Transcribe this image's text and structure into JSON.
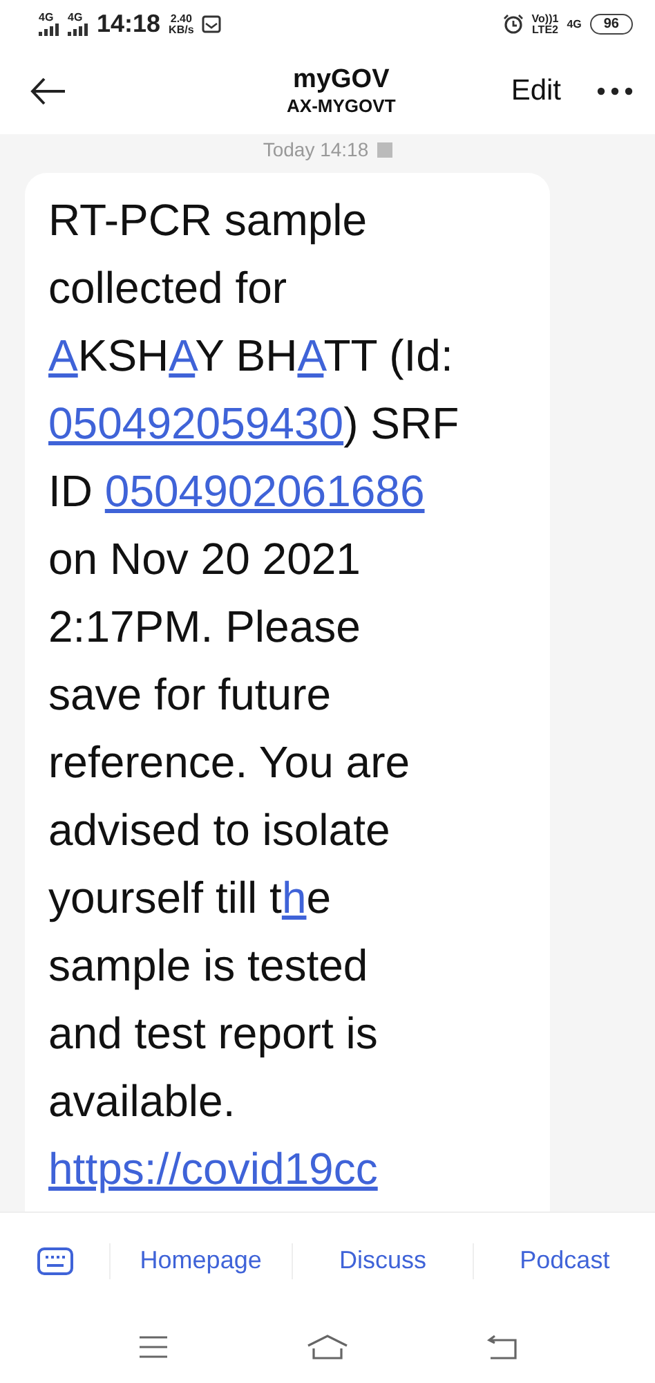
{
  "status_bar": {
    "sim1": "4G",
    "sim2": "4G",
    "time": "14:18",
    "speed": "2.40",
    "speed_unit": "KB/s",
    "volte": "Vo))1",
    "lte": "LTE2",
    "network": "4G",
    "battery": "96"
  },
  "header": {
    "title": "myGOV",
    "subtitle": "AX-MYGOVT",
    "edit": "Edit"
  },
  "date": "Today 14:18",
  "message": {
    "lines": [
      [
        {
          "kind": "text",
          "text": "RT-PCR sample"
        }
      ],
      [
        {
          "kind": "text",
          "text": "collected for"
        }
      ],
      [
        {
          "kind": "link",
          "text": "A"
        },
        {
          "kind": "text",
          "text": "KSH"
        },
        {
          "kind": "link",
          "text": "A"
        },
        {
          "kind": "text",
          "text": "Y BH"
        },
        {
          "kind": "link",
          "text": "A"
        },
        {
          "kind": "text",
          "text": "TT (Id:"
        }
      ],
      [
        {
          "kind": "link",
          "text": "050492059430"
        },
        {
          "kind": "text",
          "text": ") SRF"
        }
      ],
      [
        {
          "kind": "text",
          "text": "ID "
        },
        {
          "kind": "link",
          "text": "0504902061686"
        }
      ],
      [
        {
          "kind": "text",
          "text": "on Nov 20 2021"
        }
      ],
      [
        {
          "kind": "text",
          "text": "2:17PM. Please"
        }
      ],
      [
        {
          "kind": "text",
          "text": "save for future"
        }
      ],
      [
        {
          "kind": "text",
          "text": "reference. You are"
        }
      ],
      [
        {
          "kind": "text",
          "text": "advised to isolate"
        }
      ],
      [
        {
          "kind": "text",
          "text": "yourself till t"
        },
        {
          "kind": "link",
          "text": "h"
        },
        {
          "kind": "text",
          "text": "e"
        }
      ],
      [
        {
          "kind": "text",
          "text": "sample is tested"
        }
      ],
      [
        {
          "kind": "text",
          "text": "and test report is"
        }
      ],
      [
        {
          "kind": "text",
          "text": "available."
        }
      ],
      [
        {
          "kind": "link",
          "text": "https://covid19cc"
        }
      ]
    ]
  },
  "menu": [
    "Homepage",
    "Discuss",
    "Podcast"
  ]
}
